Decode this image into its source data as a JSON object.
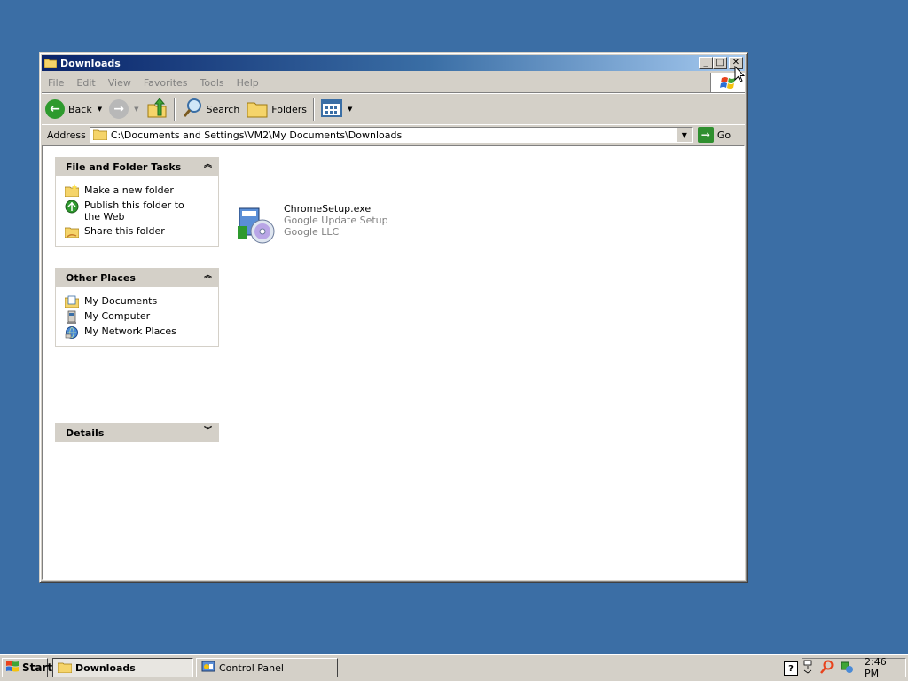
{
  "window": {
    "title": "Downloads",
    "minimize": "_",
    "maximize": "□",
    "close": "✕"
  },
  "menu": [
    "File",
    "Edit",
    "View",
    "Favorites",
    "Tools",
    "Help"
  ],
  "toolbar": {
    "back_label": "Back",
    "search_label": "Search",
    "folders_label": "Folders"
  },
  "address": {
    "label": "Address",
    "value": "C:\\Documents and Settings\\VM2\\My Documents\\Downloads",
    "go_label": "Go"
  },
  "panels": {
    "tasks": {
      "title": "File and Folder Tasks",
      "items": [
        "Make a new folder",
        "Publish this folder to the Web",
        "Share this folder"
      ]
    },
    "places": {
      "title": "Other Places",
      "items": [
        "My Documents",
        "My Computer",
        "My Network Places"
      ]
    },
    "details": {
      "title": "Details"
    }
  },
  "files": [
    {
      "name": "ChromeSetup.exe",
      "description": "Google Update Setup",
      "company": "Google LLC"
    }
  ],
  "taskbar": {
    "start_label": "Start",
    "buttons": [
      "Downloads",
      "Control Panel"
    ],
    "clock": "2:46 PM"
  },
  "colors": {
    "desktop": "#3b6ea5",
    "titlebar": "#0a246a",
    "chrome": "#d4d0c8"
  }
}
